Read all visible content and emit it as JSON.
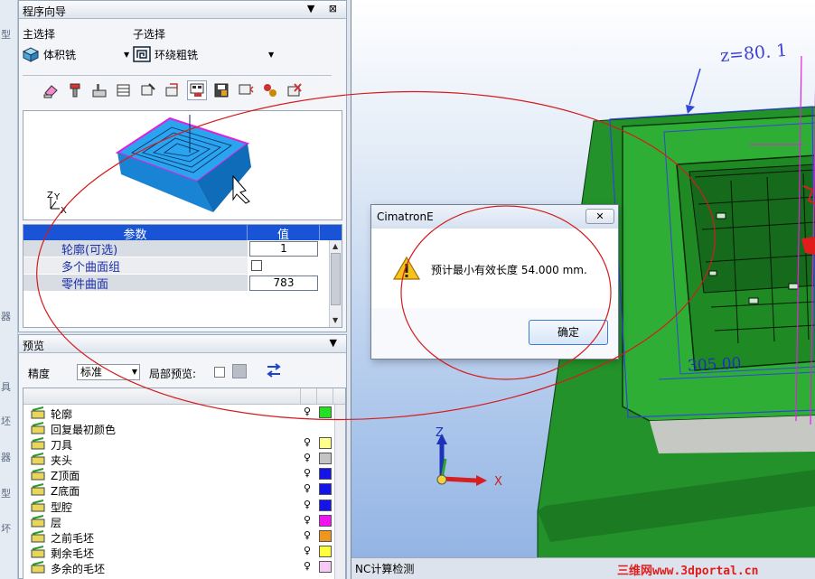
{
  "left_strip": {
    "chars": [
      "型",
      "器",
      "具",
      "坯",
      "器",
      "型",
      "坏"
    ]
  },
  "wizard": {
    "title": "程序向导",
    "title_buttons": "▼ ⊠",
    "main_select_label": "主选择",
    "main_select_value": "体积铣",
    "sub_select_label": "子选择",
    "sub_select_value": "环绕粗铣",
    "axis_labels": {
      "z": "Z",
      "y": "Y",
      "x": "X"
    },
    "params": {
      "header_param": "参数",
      "header_value": "值",
      "rows": [
        {
          "name": "轮廓(可选)",
          "value": "1",
          "type": "value"
        },
        {
          "name": "多个曲面组",
          "value": "",
          "type": "checkbox"
        },
        {
          "name": "零件曲面",
          "value": "783",
          "type": "value"
        }
      ]
    }
  },
  "preview": {
    "title": "预览",
    "pin": "▼",
    "precision_label": "精度",
    "precision_value": "标准",
    "local_preview_label": "局部预览:",
    "layers": [
      {
        "label": "轮廓",
        "color": "#22e022",
        "icon": "contour-icon"
      },
      {
        "label": "回复最初颜色",
        "color": "",
        "icon": "restore-color-icon"
      },
      {
        "label": "刀具",
        "color": "#ffff8c",
        "icon": "tool-icon"
      },
      {
        "label": "夹头",
        "color": "#c4c4c4",
        "icon": "holder-icon"
      },
      {
        "label": "Z顶面",
        "color": "#1414e6",
        "icon": "z-top-icon"
      },
      {
        "label": "Z底面",
        "color": "#1414e6",
        "icon": "z-bottom-icon"
      },
      {
        "label": "型腔",
        "color": "#1414e6",
        "icon": "cavity-icon"
      },
      {
        "label": "层",
        "color": "#f014f0",
        "icon": "layer-icon"
      },
      {
        "label": "之前毛坯",
        "color": "#f0961e",
        "icon": "previous-stock-icon"
      },
      {
        "label": "剩余毛坯",
        "color": "#ffff3c",
        "icon": "remaining-stock-icon"
      },
      {
        "label": "多余的毛坯",
        "color": "#f5c8f5",
        "icon": "excess-stock-icon"
      }
    ]
  },
  "viewport": {
    "z_value": "z=80. 1",
    "dimension": "305.00",
    "axis_z": "Z",
    "axis_x": "X"
  },
  "dialog": {
    "title": "CimatronE",
    "close_glyph": "✕",
    "message": "预计最小有效长度 54.000 mm.",
    "ok_label": "确定"
  },
  "status_bar": {
    "text": "NC计算检测",
    "watermark": "三维网www.3dportal.cn"
  }
}
